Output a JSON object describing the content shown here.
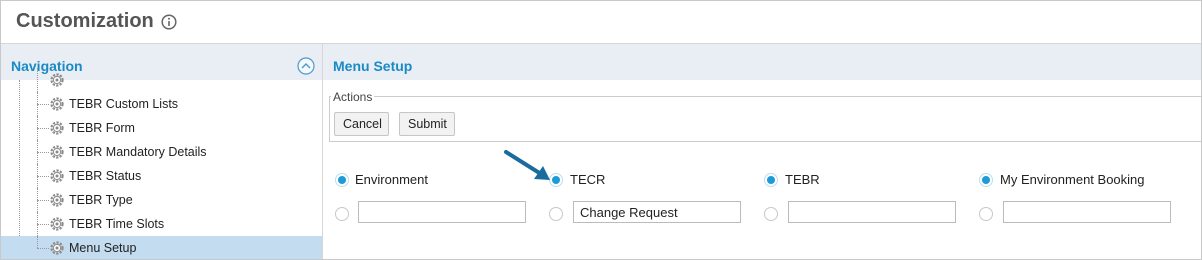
{
  "page": {
    "title": "Customization",
    "info_icon": "info-circle-icon"
  },
  "navigation": {
    "title": "Navigation",
    "collapse_icon": "chevron-up-circle-icon",
    "items": [
      {
        "label": "TEBR Custom Lists",
        "icon": "gear-icon",
        "selected": false
      },
      {
        "label": "TEBR Form",
        "icon": "gear-icon",
        "selected": false
      },
      {
        "label": "TEBR Mandatory Details",
        "icon": "gear-icon",
        "selected": false
      },
      {
        "label": "TEBR Status",
        "icon": "gear-icon",
        "selected": false
      },
      {
        "label": "TEBR Type",
        "icon": "gear-icon",
        "selected": false
      },
      {
        "label": "TEBR Time Slots",
        "icon": "gear-icon",
        "selected": false
      },
      {
        "label": "Menu Setup",
        "icon": "gear-icon",
        "selected": true
      }
    ]
  },
  "content": {
    "title": "Menu Setup",
    "actions": {
      "legend": "Actions",
      "cancel_label": "Cancel",
      "submit_label": "Submit"
    },
    "options": [
      {
        "label": "Environment",
        "checked": true,
        "input_value": "",
        "input_radio_checked": false
      },
      {
        "label": "TECR",
        "checked": true,
        "input_value": "Change Request",
        "input_radio_checked": false
      },
      {
        "label": "TEBR",
        "checked": true,
        "input_value": "",
        "input_radio_checked": false
      },
      {
        "label": "My Environment Booking",
        "checked": true,
        "input_value": "",
        "input_radio_checked": false
      }
    ],
    "annotation": "arrow-pointer-icon"
  },
  "colors": {
    "accent": "#1a8ac6",
    "header_bg": "#e8eef3",
    "selected_bg": "#c4dcef",
    "radio_checked": "#1e9ad6",
    "arrow": "#1a6b9e"
  }
}
